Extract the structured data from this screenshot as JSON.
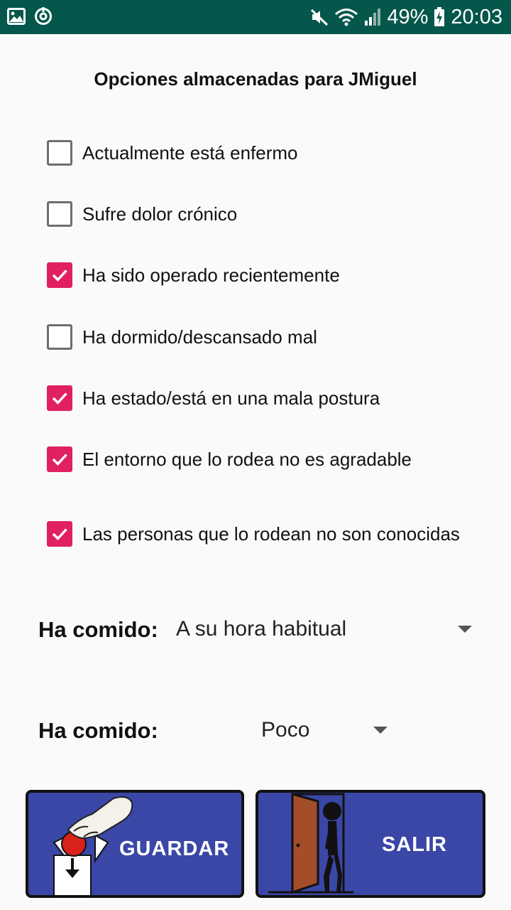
{
  "status_bar": {
    "battery_percent": "49%",
    "time": "20:03"
  },
  "title": "Opciones almacenadas para JMiguel",
  "options": [
    {
      "label": "Actualmente está enfermo",
      "checked": false
    },
    {
      "label": "Sufre dolor crónico",
      "checked": false
    },
    {
      "label": "Ha sido operado recientemente",
      "checked": true
    },
    {
      "label": "Ha dormido/descansado mal",
      "checked": false
    },
    {
      "label": "Ha estado/está en una mala postura",
      "checked": true
    },
    {
      "label": "El entorno que lo rodea no es agradable",
      "checked": true
    },
    {
      "label": "Las personas que lo rodean no son conocidas",
      "checked": true
    }
  ],
  "selects": [
    {
      "label": "Ha comido:",
      "value": "A su hora habitual"
    },
    {
      "label": "Ha comido:",
      "value": "Poco"
    }
  ],
  "buttons": {
    "save": "GUARDAR",
    "exit": "SALIR"
  },
  "colors": {
    "status_bar": "#04574a",
    "checkbox_checked": "#e0205f",
    "button_bg": "#3a47a7",
    "door": "#a24e2a"
  }
}
